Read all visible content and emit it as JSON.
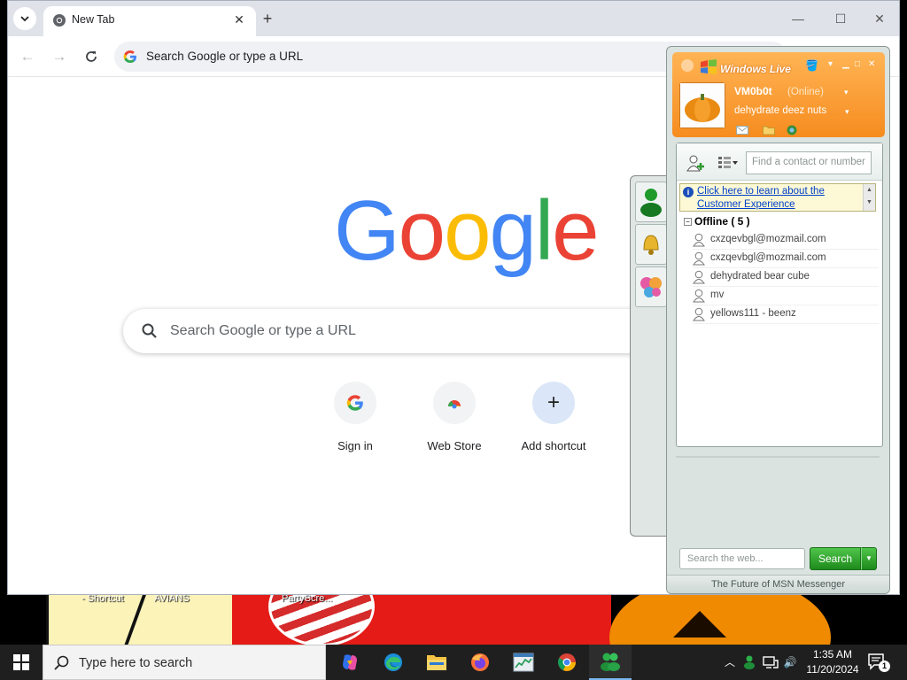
{
  "browser": {
    "tab_title": "New Tab",
    "omnibox_placeholder": "Search Google or type a URL",
    "search_placeholder": "Search Google or type a URL",
    "logo_letters": [
      "G",
      "o",
      "o",
      "g",
      "l",
      "e"
    ],
    "logo_colors": [
      "#4285F4",
      "#EA4335",
      "#FBBC05",
      "#4285F4",
      "#34A853",
      "#EA4335"
    ],
    "shortcuts": [
      {
        "label": "Sign in",
        "icon": "google-g-icon"
      },
      {
        "label": "Web Store",
        "icon": "chrome-webstore-icon"
      },
      {
        "label": "Add shortcut",
        "icon": "plus-icon"
      }
    ]
  },
  "desktop": {
    "labels": [
      "- Shortcut",
      "AVIANS",
      "PartyScre..."
    ]
  },
  "messenger": {
    "title": "Windows Live",
    "display_name": "VM0b0t",
    "status": "(Online)",
    "personal_message": "dehydrate deez nuts",
    "contact_search_placeholder": "Find a contact or number",
    "info_link": "Click here to learn about the Customer Experience",
    "group_name": "Offline ( 5 )",
    "contacts": [
      "cxzqevbgl@mozmail.com",
      "cxzqevbgl@mozmail.com",
      "dehydrated bear cube",
      "mv",
      "yellows111 - beenz"
    ],
    "web_search_placeholder": "Search the web...",
    "search_button": "Search",
    "footer": "The Future of MSN Messenger",
    "accent_color": "#f68c1f"
  },
  "taskbar": {
    "search_placeholder": "Type here to search",
    "apps": [
      "copilot-icon",
      "edge-icon",
      "file-explorer-icon",
      "firefox-icon",
      "task-manager-icon",
      "chrome-icon",
      "messenger-icon"
    ],
    "time": "1:35 AM",
    "date": "11/20/2024",
    "notification_count": "1"
  }
}
